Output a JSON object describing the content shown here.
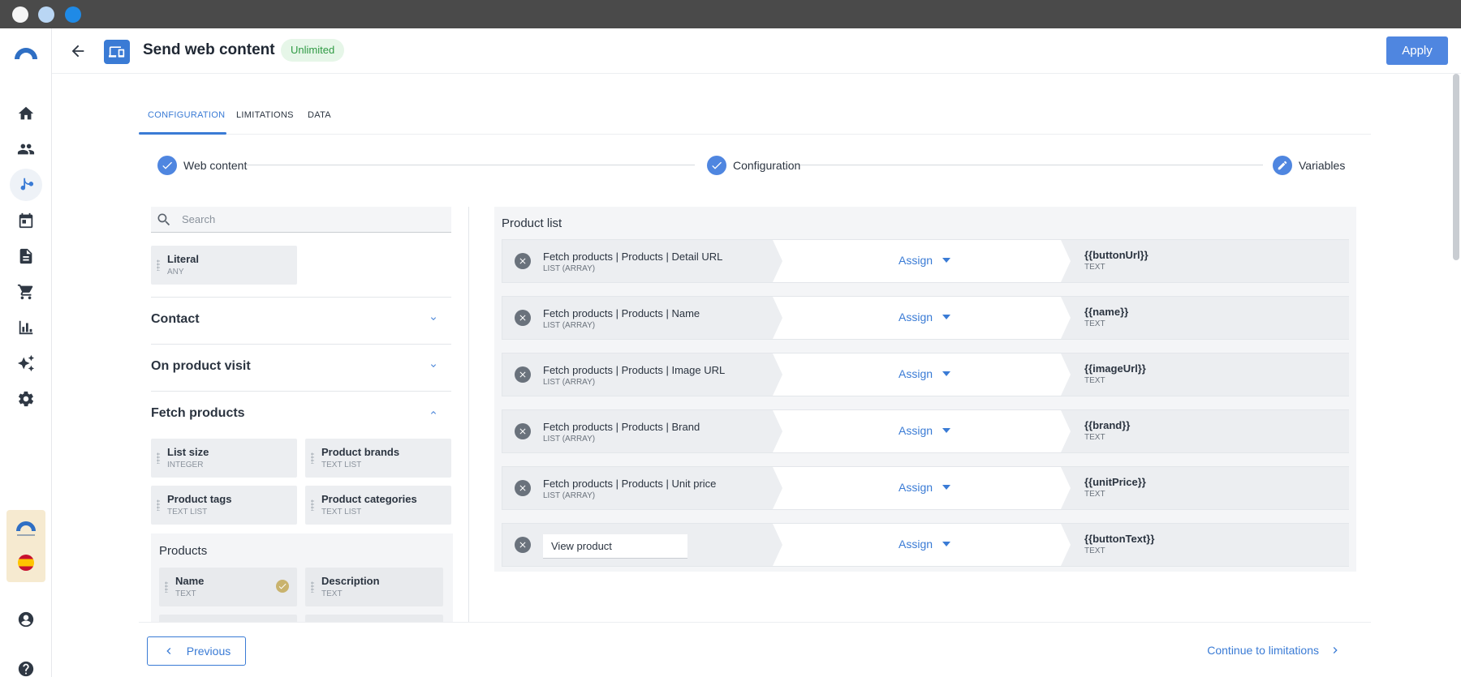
{
  "header": {
    "title": "Send web content",
    "badge": "Unlimited",
    "apply_label": "Apply"
  },
  "tabs": [
    {
      "label": "CONFIGURATION",
      "active": true
    },
    {
      "label": "LIMITATIONS",
      "active": false
    },
    {
      "label": "DATA",
      "active": false
    }
  ],
  "stepper": [
    {
      "label": "Web content",
      "state": "done"
    },
    {
      "label": "Configuration",
      "state": "done"
    },
    {
      "label": "Variables",
      "state": "editing"
    }
  ],
  "left_panel": {
    "search_placeholder": "Search",
    "literal": {
      "name": "Literal",
      "type": "ANY"
    },
    "groups": [
      {
        "title": "Contact",
        "expanded": false
      },
      {
        "title": "On product visit",
        "expanded": false
      },
      {
        "title": "Fetch products",
        "expanded": true
      }
    ],
    "fetch_products_fields": [
      {
        "name": "List size",
        "type": "INTEGER"
      },
      {
        "name": "Product brands",
        "type": "TEXT LIST"
      },
      {
        "name": "Product tags",
        "type": "TEXT LIST"
      },
      {
        "name": "Product categories",
        "type": "TEXT LIST"
      }
    ],
    "products": {
      "title": "Products",
      "fields": [
        {
          "name": "Name",
          "type": "TEXT",
          "used": true
        },
        {
          "name": "Description",
          "type": "TEXT",
          "used": false
        }
      ]
    }
  },
  "mapping": {
    "title": "Product list",
    "rows": [
      {
        "source": "Fetch products | Products | Detail URL",
        "source_type": "LIST (ARRAY)",
        "action": "Assign",
        "target": "{{buttonUrl}}",
        "target_type": "TEXT"
      },
      {
        "source": "Fetch products | Products | Name",
        "source_type": "LIST (ARRAY)",
        "action": "Assign",
        "target": "{{name}}",
        "target_type": "TEXT"
      },
      {
        "source": "Fetch products | Products | Image URL",
        "source_type": "LIST (ARRAY)",
        "action": "Assign",
        "target": "{{imageUrl}}",
        "target_type": "TEXT"
      },
      {
        "source": "Fetch products | Products | Brand",
        "source_type": "LIST (ARRAY)",
        "action": "Assign",
        "target": "{{brand}}",
        "target_type": "TEXT"
      },
      {
        "source": "Fetch products | Products | Unit price",
        "source_type": "LIST (ARRAY)",
        "action": "Assign",
        "target": "{{unitPrice}}",
        "target_type": "TEXT"
      }
    ],
    "literal_row": {
      "value": "View product",
      "action": "Assign",
      "target": "{{buttonText}}",
      "target_type": "TEXT"
    }
  },
  "footer": {
    "previous_label": "Previous",
    "next_label": "Continue to limitations"
  },
  "colors": {
    "accent": "#3a7bd5",
    "apply_button": "#4f86e0",
    "badge_bg": "#e6f6e8",
    "badge_text": "#2f9a43"
  },
  "icons": [
    "home-icon",
    "people-icon",
    "flow-icon",
    "calendar-icon",
    "document-icon",
    "cart-icon",
    "chart-icon",
    "sparkle-icon",
    "settings-icon",
    "account-icon",
    "help-icon"
  ]
}
